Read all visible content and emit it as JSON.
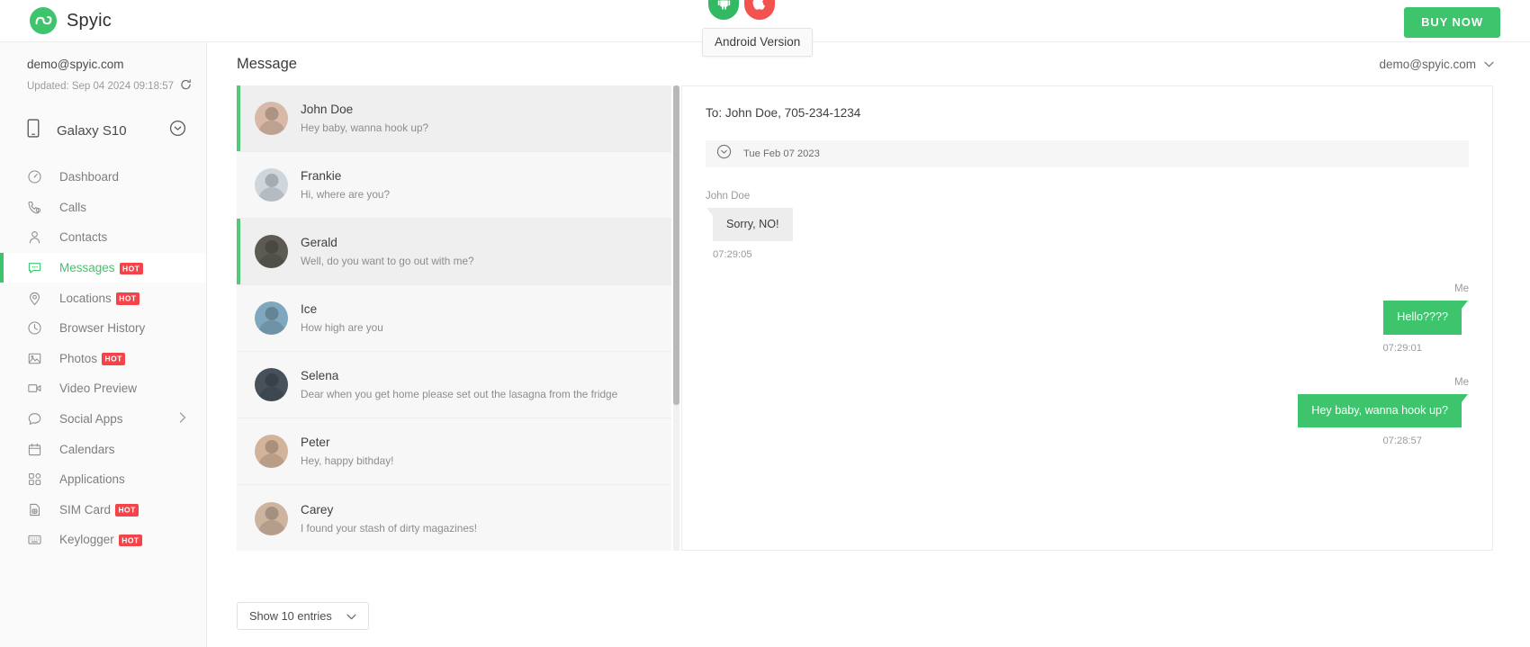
{
  "header": {
    "brand_name": "Spyic",
    "brand_icon": "spyic-logo-icon",
    "platforms": [
      {
        "name": "android",
        "icon": "android-icon",
        "color": "#33b864"
      },
      {
        "name": "apple",
        "icon": "apple-icon",
        "color": "#f2534f"
      }
    ],
    "tooltip": "Android Version",
    "buy_now_label": "BUY NOW"
  },
  "sidebar": {
    "account_email": "demo@spyic.com",
    "updated_text": "Updated: Sep 04 2024 09:18:57",
    "refresh_icon": "refresh-icon",
    "device": {
      "name": "Galaxy S10",
      "icon": "phone-icon",
      "chevron": "chevron-down-circle-icon"
    },
    "items": [
      {
        "label": "Dashboard",
        "icon": "dashboard-icon",
        "badge": "",
        "active": false,
        "chevron": false
      },
      {
        "label": "Calls",
        "icon": "phone-call-icon",
        "badge": "",
        "active": false,
        "chevron": false
      },
      {
        "label": "Contacts",
        "icon": "user-icon",
        "badge": "",
        "active": false,
        "chevron": false
      },
      {
        "label": "Messages",
        "icon": "message-icon",
        "badge": "HOT",
        "active": true,
        "chevron": false
      },
      {
        "label": "Locations",
        "icon": "location-pin-icon",
        "badge": "HOT",
        "active": false,
        "chevron": false
      },
      {
        "label": "Browser History",
        "icon": "clock-icon",
        "badge": "",
        "active": false,
        "chevron": false
      },
      {
        "label": "Photos",
        "icon": "image-icon",
        "badge": "HOT",
        "active": false,
        "chevron": false
      },
      {
        "label": "Video Preview",
        "icon": "video-camera-icon",
        "badge": "",
        "active": false,
        "chevron": false
      },
      {
        "label": "Social Apps",
        "icon": "chat-bubble-icon",
        "badge": "",
        "active": false,
        "chevron": true
      },
      {
        "label": "Calendars",
        "icon": "calendar-icon",
        "badge": "",
        "active": false,
        "chevron": false
      },
      {
        "label": "Applications",
        "icon": "apps-grid-icon",
        "badge": "",
        "active": false,
        "chevron": false
      },
      {
        "label": "SIM Card",
        "icon": "sim-card-icon",
        "badge": "HOT",
        "active": false,
        "chevron": false
      },
      {
        "label": "Keylogger",
        "icon": "keyboard-icon",
        "badge": "HOT",
        "active": false,
        "chevron": false
      }
    ]
  },
  "main": {
    "page_title": "Message",
    "account_menu": {
      "label": "demo@spyic.com",
      "chevron": "chevron-down-icon"
    },
    "conversations": [
      {
        "name": "John Doe",
        "preview": "Hey baby, wanna hook up?",
        "unread": true,
        "avatar": "avatar"
      },
      {
        "name": "Frankie",
        "preview": "Hi, where are you?",
        "unread": false,
        "avatar": "avatar"
      },
      {
        "name": "Gerald",
        "preview": "Well, do you want to go out with me?",
        "unread": true,
        "avatar": "avatar"
      },
      {
        "name": "Ice",
        "preview": "How high are you",
        "unread": false,
        "avatar": "avatar"
      },
      {
        "name": "Selena",
        "preview": "Dear when you get home please set out the lasagna from the fridge",
        "unread": false,
        "avatar": "avatar"
      },
      {
        "name": "Peter",
        "preview": "Hey, happy bithday!",
        "unread": false,
        "avatar": "avatar"
      },
      {
        "name": "Carey",
        "preview": "I found your stash of dirty magazines!",
        "unread": false,
        "avatar": "avatar"
      }
    ],
    "thread": {
      "recipient": "To: John Doe, 705-234-1234",
      "date_divider": "Tue Feb 07 2023",
      "date_icon": "chevron-down-circle-icon",
      "messages": [
        {
          "sender": "John Doe",
          "text": "Sorry, NO!",
          "time": "07:29:05",
          "direction": "in"
        },
        {
          "sender": "Me",
          "text": "Hello????",
          "time": "07:29:01",
          "direction": "out"
        },
        {
          "sender": "Me",
          "text": "Hey baby, wanna hook up?",
          "time": "07:28:57",
          "direction": "out"
        }
      ]
    },
    "entries_select": {
      "label": "Show 10 entries",
      "chevron": "chevron-down-icon"
    }
  },
  "colors": {
    "accent": "#3ec46d",
    "hot_badge": "#f4444a",
    "android": "#33b864",
    "apple": "#f2534f"
  }
}
